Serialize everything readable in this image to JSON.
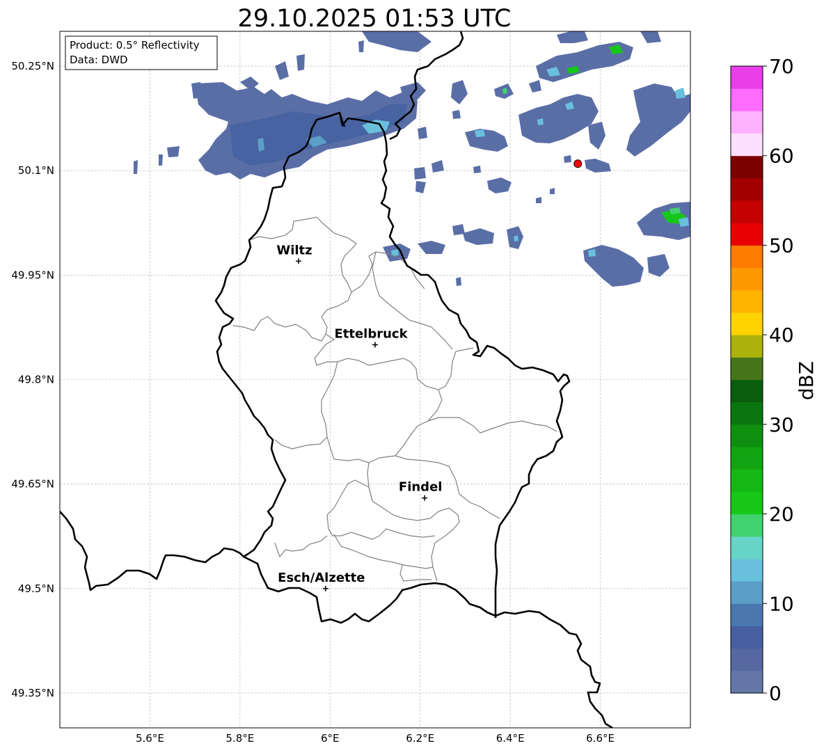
{
  "title": "29.10.2025 01:53 UTC",
  "info_box": {
    "product": "Product: 0.5° Reflectivity",
    "source": "Data: DWD"
  },
  "map": {
    "lon_range": [
      5.4,
      6.8
    ],
    "lat_range": [
      49.3,
      50.3
    ],
    "lon_ticks": [
      {
        "value": 5.6,
        "label": "5.6°E"
      },
      {
        "value": 5.8,
        "label": "5.8°E"
      },
      {
        "value": 6.0,
        "label": "6°E"
      },
      {
        "value": 6.2,
        "label": "6.2°E"
      },
      {
        "value": 6.4,
        "label": "6.4°E"
      },
      {
        "value": 6.6,
        "label": "6.6°E"
      }
    ],
    "lat_ticks": [
      {
        "value": 50.25,
        "label": "50.25°N"
      },
      {
        "value": 50.1,
        "label": "50.1°N"
      },
      {
        "value": 49.95,
        "label": "49.95°N"
      },
      {
        "value": 49.8,
        "label": "49.8°N"
      },
      {
        "value": 49.65,
        "label": "49.65°N"
      },
      {
        "value": 49.5,
        "label": "49.5°N"
      },
      {
        "value": 49.35,
        "label": "49.35°N"
      }
    ],
    "grid": "dashed",
    "cities": [
      {
        "name": "Wiltz",
        "lon": 5.93,
        "lat": 49.97
      },
      {
        "name": "Ettelbruck",
        "lon": 6.1,
        "lat": 49.85
      },
      {
        "name": "Findel",
        "lon": 6.21,
        "lat": 49.63
      },
      {
        "name": "Esch/Alzette",
        "lon": 5.99,
        "lat": 49.5
      }
    ],
    "radar_site": {
      "lon": 6.55,
      "lat": 50.11,
      "color": "#ff0000"
    }
  },
  "colorbar": {
    "label": "dBZ",
    "min": 0,
    "max": 70,
    "step": 2.5,
    "tick_labels": [
      "0",
      "10",
      "20",
      "30",
      "40",
      "50",
      "60",
      "70"
    ],
    "colors": [
      "#6477a8",
      "#56689f",
      "#465fa0",
      "#4a78ae",
      "#5b9ec8",
      "#68c0dd",
      "#66d5c7",
      "#3fd26f",
      "#16c71a",
      "#15b715",
      "#12a412",
      "#0f8f10",
      "#0b7610",
      "#095d0c",
      "#46751b",
      "#aab20b",
      "#ffd300",
      "#ffb400",
      "#ff9900",
      "#ff7c00",
      "#e80000",
      "#c40000",
      "#a30000",
      "#7c0000",
      "#ffdfff",
      "#ffb3ff",
      "#ff6cff",
      "#e93fe9"
    ]
  }
}
